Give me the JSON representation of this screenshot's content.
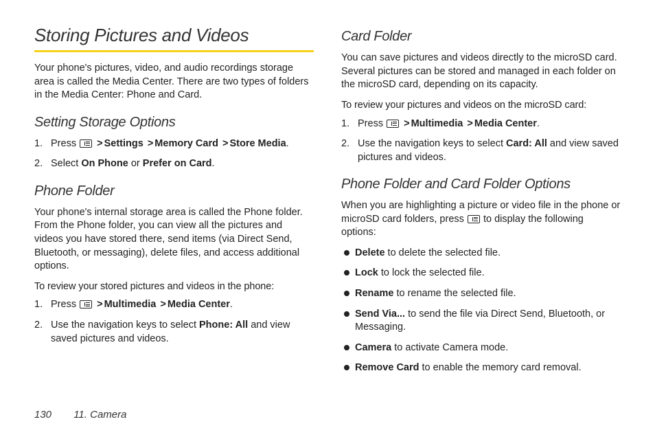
{
  "footer": {
    "page": "130",
    "section": "11. Camera"
  },
  "col1": {
    "h1": "Storing Pictures and Videos",
    "intro": "Your phone's pictures, video, and audio recordings storage area is called the Media Center. There are two types of folders in the Media Center: Phone and Card.",
    "h2a": "Setting Storage Options",
    "step1_press": "Press ",
    "step1_path": [
      "Settings",
      "Memory Card",
      "Store Media"
    ],
    "step2_pre": "Select ",
    "step2_a": "On Phone",
    "step2_mid": " or ",
    "step2_b": "Prefer on Card",
    "h2b": "Phone Folder",
    "phone_para": "Your phone's internal storage area is called the Phone folder. From the Phone folder, you can view all the pictures and videos you have stored there, send items (via Direct Send, Bluetooth, or messaging), delete files, and access additional options.",
    "phone_lead": "To review your stored pictures and videos in the phone:",
    "pstep1_press": "Press ",
    "pstep1_path": [
      "Multimedia",
      "Media Center"
    ],
    "pstep2_pre": "Use the navigation keys to select ",
    "pstep2_bold": "Phone: All",
    "pstep2_post": " and view saved pictures and videos."
  },
  "col2": {
    "h2a": "Card Folder",
    "card_para": "You can save pictures and videos directly to the microSD card. Several pictures can be stored and managed in each folder on the microSD card, depending on its capacity.",
    "card_lead": "To review your pictures and videos on the microSD card:",
    "cstep1_press": "Press ",
    "cstep1_path": [
      "Multimedia",
      "Media Center"
    ],
    "cstep2_pre": "Use the navigation keys to select ",
    "cstep2_bold": "Card: All",
    "cstep2_post": " and view saved pictures and videos.",
    "h2b": "Phone Folder and Card Folder Options",
    "opt_intro_pre": "When you are highlighting a picture or video file in the phone or microSD card folders, press ",
    "opt_intro_post": " to display the following options:",
    "opts": [
      {
        "b": "Delete",
        "t": " to delete the selected file."
      },
      {
        "b": "Lock",
        "t": " to lock the selected file."
      },
      {
        "b": "Rename",
        "t": " to rename the selected file."
      },
      {
        "b": "Send Via...",
        "t": " to send the file via Direct Send, Bluetooth, or Messaging."
      },
      {
        "b": "Camera",
        "t": " to activate Camera mode."
      },
      {
        "b": "Remove Card",
        "t": " to enable the memory card removal."
      }
    ]
  }
}
